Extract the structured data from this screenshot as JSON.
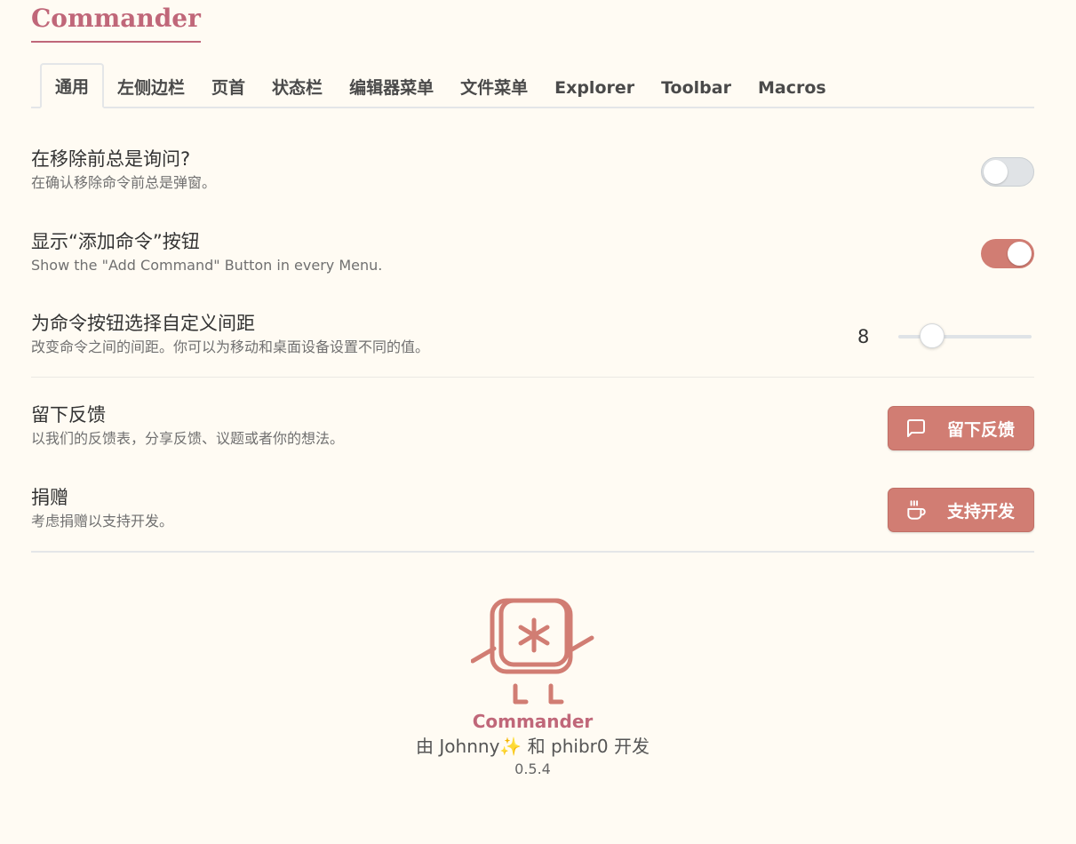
{
  "app": {
    "title": "Commander"
  },
  "tabs": [
    {
      "label": "通用",
      "active": true
    },
    {
      "label": "左侧边栏"
    },
    {
      "label": "页首"
    },
    {
      "label": "状态栏"
    },
    {
      "label": "编辑器菜单"
    },
    {
      "label": "文件菜单"
    },
    {
      "label": "Explorer"
    },
    {
      "label": "Toolbar"
    },
    {
      "label": "Macros"
    }
  ],
  "settings": {
    "confirm_remove": {
      "name": "在移除前总是询问?",
      "desc": "在确认移除命令前总是弹窗。",
      "enabled": false
    },
    "show_add_button": {
      "name": "显示“添加命令”按钮",
      "desc": "Show the \"Add Command\" Button in every Menu.",
      "enabled": true
    },
    "spacing": {
      "name": "为命令按钮选择自定义间距",
      "desc": "改变命令之间的间距。你可以为移动和桌面设备设置不同的值。",
      "value": "8",
      "fraction": 0.2
    },
    "feedback": {
      "name": "留下反馈",
      "desc": "以我们的反馈表，分享反馈、议题或者你的想法。",
      "button_label": "留下反馈",
      "icon": "message-square-icon"
    },
    "donate": {
      "name": "捐赠",
      "desc": "考虑捐赠以支持开发。",
      "button_label": "支持开发",
      "icon": "coffee-cup-icon"
    }
  },
  "footer": {
    "name": "Commander",
    "credit": "由 Johnny✨ 和 phibr0 开发",
    "version": "0.5.4"
  },
  "colors": {
    "accent": "#d17d73",
    "title": "#c06779",
    "background": "#fffbf3"
  }
}
